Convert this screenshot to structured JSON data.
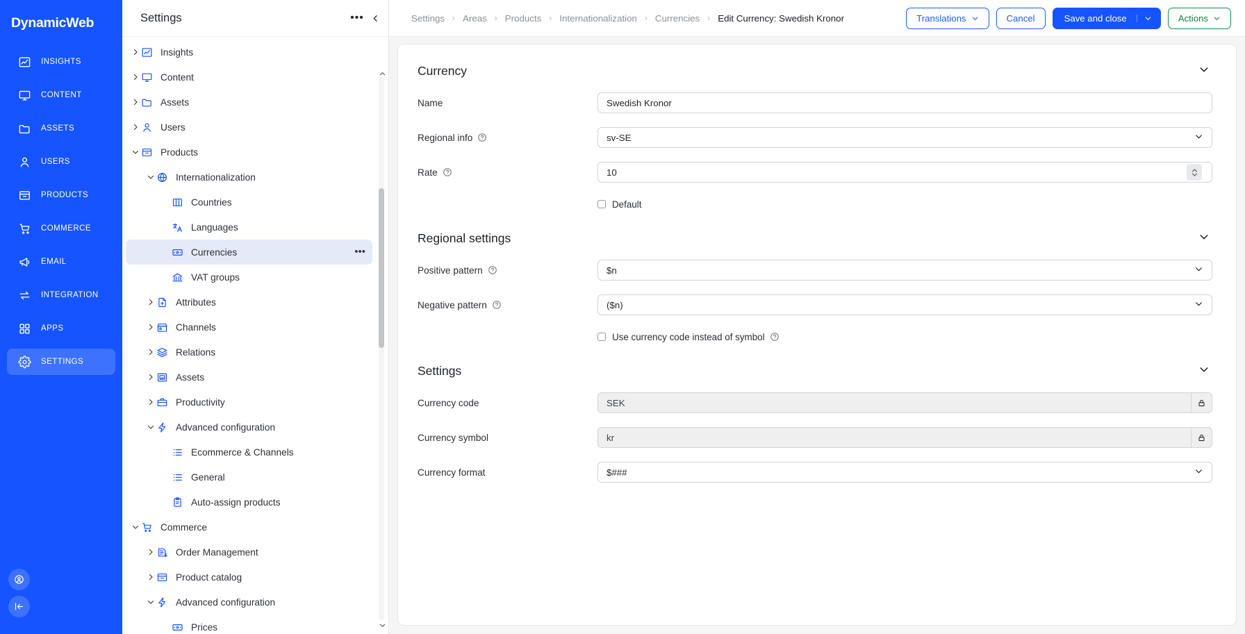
{
  "brand": {
    "name": "DynamicWeb",
    "accent": "#1654ff",
    "accent_active": "#3d72ff"
  },
  "rail": {
    "items": [
      {
        "label": "INSIGHTS",
        "icon": "chart-line-icon",
        "active": false
      },
      {
        "label": "CONTENT",
        "icon": "monitor-icon",
        "active": false
      },
      {
        "label": "ASSETS",
        "icon": "folder-icon",
        "active": false
      },
      {
        "label": "USERS",
        "icon": "user-icon",
        "active": false
      },
      {
        "label": "PRODUCTS",
        "icon": "archive-box-icon",
        "active": false
      },
      {
        "label": "COMMERCE",
        "icon": "shopping-cart-icon",
        "active": false
      },
      {
        "label": "EMAIL",
        "icon": "megaphone-icon",
        "active": false
      },
      {
        "label": "INTEGRATION",
        "icon": "exchange-arrows-icon",
        "active": false
      },
      {
        "label": "APPS",
        "icon": "grid-apps-icon",
        "active": false
      },
      {
        "label": "SETTINGS",
        "icon": "gear-icon",
        "active": true
      }
    ],
    "bottom": [
      {
        "icon": "account-circle-icon"
      },
      {
        "icon": "collapse-panel-icon"
      }
    ]
  },
  "tree": {
    "title": "Settings",
    "more_label": "•••",
    "collapse_icon": "chevron-left-icon",
    "nodes": [
      {
        "label": "Insights",
        "icon": "chart-line-icon",
        "depth": 0,
        "caret": "collapsed"
      },
      {
        "label": "Content",
        "icon": "monitor-icon",
        "depth": 0,
        "caret": "collapsed"
      },
      {
        "label": "Assets",
        "icon": "folder-icon",
        "depth": 0,
        "caret": "collapsed"
      },
      {
        "label": "Users",
        "icon": "user-icon",
        "depth": 0,
        "caret": "collapsed"
      },
      {
        "label": "Products",
        "icon": "archive-box-icon",
        "depth": 0,
        "caret": "expanded"
      },
      {
        "label": "Internationalization",
        "icon": "globe-icon",
        "depth": 1,
        "caret": "expanded"
      },
      {
        "label": "Countries",
        "icon": "map-icon",
        "depth": 2,
        "caret": "none"
      },
      {
        "label": "Languages",
        "icon": "translate-icon",
        "depth": 2,
        "caret": "none"
      },
      {
        "label": "Currencies",
        "icon": "banknote-icon",
        "depth": 2,
        "caret": "none",
        "selected": true,
        "dots": true
      },
      {
        "label": "VAT groups",
        "icon": "bank-icon",
        "depth": 2,
        "caret": "none"
      },
      {
        "label": "Attributes",
        "icon": "file-plus-icon",
        "depth": 1,
        "caret": "collapsed"
      },
      {
        "label": "Channels",
        "icon": "storefront-icon",
        "depth": 1,
        "caret": "collapsed"
      },
      {
        "label": "Relations",
        "icon": "layers-icon",
        "depth": 1,
        "caret": "collapsed"
      },
      {
        "label": "Assets",
        "icon": "image-frame-icon",
        "depth": 1,
        "caret": "collapsed"
      },
      {
        "label": "Productivity",
        "icon": "briefcase-icon",
        "depth": 1,
        "caret": "collapsed"
      },
      {
        "label": "Advanced configuration",
        "icon": "bolt-icon",
        "depth": 1,
        "caret": "expanded"
      },
      {
        "label": "Ecommerce & Channels",
        "icon": "list-icon",
        "depth": 2,
        "caret": "none"
      },
      {
        "label": "General",
        "icon": "list-icon",
        "depth": 2,
        "caret": "none"
      },
      {
        "label": "Auto-assign products",
        "icon": "clipboard-icon",
        "depth": 2,
        "caret": "none"
      },
      {
        "label": "Commerce",
        "icon": "shopping-cart-icon",
        "depth": 0,
        "caret": "expanded"
      },
      {
        "label": "Order Management",
        "icon": "order-doc-icon",
        "depth": 1,
        "caret": "collapsed"
      },
      {
        "label": "Product catalog",
        "icon": "archive-box-icon",
        "depth": 1,
        "caret": "collapsed"
      },
      {
        "label": "Advanced configuration",
        "icon": "bolt-icon",
        "depth": 1,
        "caret": "expanded"
      },
      {
        "label": "Prices",
        "icon": "banknote-icon",
        "depth": 2,
        "caret": "none"
      }
    ]
  },
  "topbar": {
    "breadcrumbs": [
      {
        "label": "Settings",
        "current": false
      },
      {
        "label": "Areas",
        "current": false
      },
      {
        "label": "Products",
        "current": false
      },
      {
        "label": "Internationalization",
        "current": false
      },
      {
        "label": "Currencies",
        "current": false
      },
      {
        "label": "Edit Currency: Swedish Kronor",
        "current": true
      }
    ],
    "separator": "›",
    "buttons": {
      "translations": "Translations",
      "cancel": "Cancel",
      "save_and_close": "Save and close",
      "actions": "Actions"
    }
  },
  "form": {
    "sections": [
      {
        "title": "Currency",
        "rows": [
          {
            "label": "Name",
            "help": false,
            "type": "text",
            "value": "Swedish Kronor",
            "locked": false
          },
          {
            "label": "Regional info",
            "help": true,
            "type": "select",
            "value": "sv-SE",
            "locked": false
          },
          {
            "label": "Rate",
            "help": true,
            "type": "number",
            "value": "10",
            "locked": false
          }
        ],
        "checkbox": {
          "label": "Default",
          "checked": false,
          "help": false
        }
      },
      {
        "title": "Regional settings",
        "rows": [
          {
            "label": "Positive pattern",
            "help": true,
            "type": "select",
            "value": "$n",
            "locked": false
          },
          {
            "label": "Negative pattern",
            "help": true,
            "type": "select",
            "value": "($n)",
            "locked": false
          }
        ],
        "checkbox": {
          "label": "Use currency code instead of symbol",
          "checked": false,
          "help": true
        }
      },
      {
        "title": "Settings",
        "rows": [
          {
            "label": "Currency code",
            "help": false,
            "type": "text",
            "value": "SEK",
            "locked": true
          },
          {
            "label": "Currency symbol",
            "help": false,
            "type": "text",
            "value": "kr",
            "locked": true
          },
          {
            "label": "Currency format",
            "help": false,
            "type": "select",
            "value": "$###",
            "locked": false
          }
        ],
        "checkbox": null
      }
    ]
  }
}
